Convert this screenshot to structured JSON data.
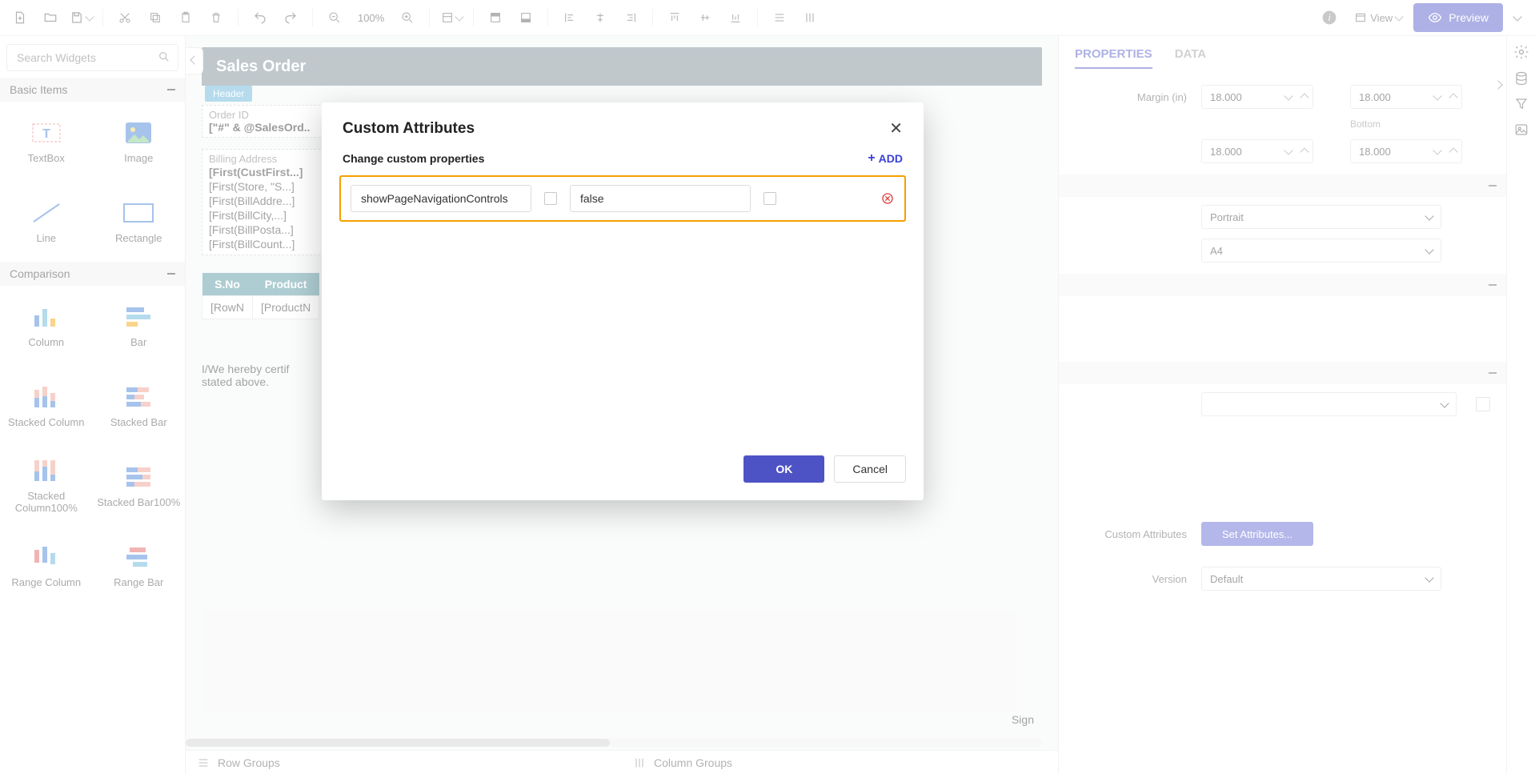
{
  "toolbar": {
    "zoom": "100%",
    "view_label": "View",
    "preview_label": "Preview"
  },
  "widgets": {
    "search_placeholder": "Search Widgets",
    "categories": [
      {
        "name": "Basic Items"
      },
      {
        "name": "Comparison"
      }
    ],
    "basic_items": [
      {
        "label": "TextBox"
      },
      {
        "label": "Image"
      },
      {
        "label": "Line"
      },
      {
        "label": "Rectangle"
      }
    ],
    "comparison_items": [
      {
        "label": "Column"
      },
      {
        "label": "Bar"
      },
      {
        "label": "Stacked Column"
      },
      {
        "label": "Stacked Bar"
      },
      {
        "label": "Stacked Column100%"
      },
      {
        "label": "Stacked Bar100%"
      },
      {
        "label": "Range Column"
      },
      {
        "label": "Range Bar"
      }
    ]
  },
  "canvas": {
    "page_title": "Sales Order",
    "header_tab": "Header",
    "order_id_label": "Order ID",
    "order_id_value": "[\"#\" & @SalesOrd..",
    "billing_label": "Billing Address",
    "billing_lines": [
      "[First(CustFirst...]",
      "[First(Store, \"S...]",
      "[First(BillAddre...]",
      "[First(BillCity,...]",
      "[First(BillPosta...]",
      "[First(BillCount...]"
    ],
    "table": {
      "headers": [
        "S.No",
        "Product"
      ],
      "row": [
        "[RowN",
        "[ProductN"
      ]
    },
    "cert_text": "I/We hereby certif\nstated above.",
    "sign_label": "Sign",
    "row_groups": "Row Groups",
    "column_groups": "Column Groups"
  },
  "properties": {
    "tabs": {
      "properties": "PROPERTIES",
      "data": "DATA"
    },
    "margin_label": "Margin (in)",
    "margin_left": "18.000",
    "margin_right": "18.000",
    "bottom_label": "Bottom",
    "margin_top2": "18.000",
    "margin_bottom": "18.000",
    "orientation": "Portrait",
    "paper": "A4",
    "custom_attr_label": "Custom Attributes",
    "set_attr_label": "Set Attributes...",
    "version_label": "Version",
    "version_value": "Default"
  },
  "modal": {
    "title": "Custom Attributes",
    "subtitle": "Change custom properties",
    "add_label": "ADD",
    "row": {
      "key": "showPageNavigationControls",
      "value": "false"
    },
    "ok": "OK",
    "cancel": "Cancel"
  }
}
